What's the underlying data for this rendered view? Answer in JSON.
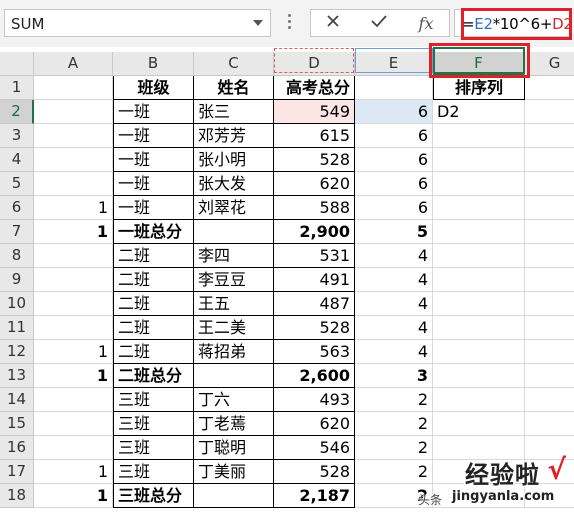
{
  "formula_bar": {
    "name_box": "SUM",
    "cancel_icon": "×",
    "enter_icon": "✓",
    "fx_label": "fx",
    "formula_parts": [
      {
        "text": "=",
        "color": "#000000"
      },
      {
        "text": "E2",
        "color": "#2f6fc7"
      },
      {
        "text": "*10^6+",
        "color": "#000000"
      },
      {
        "text": "D2",
        "color": "#d42a2a"
      }
    ]
  },
  "columns": [
    "",
    "A",
    "B",
    "C",
    "D",
    "E",
    "F",
    "G"
  ],
  "rows": [
    {
      "n": "1",
      "A": "",
      "B": "班级",
      "C": "姓名",
      "D": "高考总分",
      "E": "",
      "F": "排序列",
      "bold": true,
      "header": true
    },
    {
      "n": "2",
      "A": "",
      "B": "一班",
      "C": "张三",
      "D": "549",
      "E": "6",
      "F": "D2"
    },
    {
      "n": "3",
      "A": "",
      "B": "一班",
      "C": "邓芳芳",
      "D": "615",
      "E": "6",
      "F": ""
    },
    {
      "n": "4",
      "A": "",
      "B": "一班",
      "C": "张小明",
      "D": "528",
      "E": "6",
      "F": ""
    },
    {
      "n": "5",
      "A": "",
      "B": "一班",
      "C": "张大发",
      "D": "620",
      "E": "6",
      "F": ""
    },
    {
      "n": "6",
      "A": "1",
      "B": "一班",
      "C": "刘翠花",
      "D": "588",
      "E": "6",
      "F": ""
    },
    {
      "n": "7",
      "A": "1",
      "B": "一班总分",
      "C": "",
      "D": "2,900",
      "E": "5",
      "F": "",
      "bold": true
    },
    {
      "n": "8",
      "A": "",
      "B": "二班",
      "C": "李四",
      "D": "531",
      "E": "4",
      "F": ""
    },
    {
      "n": "9",
      "A": "",
      "B": "二班",
      "C": "李豆豆",
      "D": "491",
      "E": "4",
      "F": ""
    },
    {
      "n": "10",
      "A": "",
      "B": "二班",
      "C": "王五",
      "D": "487",
      "E": "4",
      "F": ""
    },
    {
      "n": "11",
      "A": "",
      "B": "二班",
      "C": "王二美",
      "D": "528",
      "E": "4",
      "F": ""
    },
    {
      "n": "12",
      "A": "1",
      "B": "二班",
      "C": "蒋招弟",
      "D": "563",
      "E": "4",
      "F": ""
    },
    {
      "n": "13",
      "A": "1",
      "B": "二班总分",
      "C": "",
      "D": "2,600",
      "E": "3",
      "F": "",
      "bold": true
    },
    {
      "n": "14",
      "A": "",
      "B": "三班",
      "C": "丁六",
      "D": "493",
      "E": "2",
      "F": ""
    },
    {
      "n": "15",
      "A": "",
      "B": "三班",
      "C": "丁老蔫",
      "D": "620",
      "E": "2",
      "F": ""
    },
    {
      "n": "16",
      "A": "",
      "B": "三班",
      "C": "丁聪明",
      "D": "546",
      "E": "2",
      "F": ""
    },
    {
      "n": "17",
      "A": "1",
      "B": "三班",
      "C": "丁美丽",
      "D": "528",
      "E": "2",
      "F": ""
    },
    {
      "n": "18",
      "A": "1",
      "B": "三班总分",
      "C": "",
      "D": "2,187",
      "E": "2",
      "F": "",
      "bold": true
    }
  ],
  "watermark": {
    "main": "经验啦",
    "check": "√",
    "sub": "头条",
    "url": "jingyanla.com"
  },
  "colors": {
    "accent_green": "#217346",
    "highlight_red": "#e0202a",
    "ref_blue": "#2f6fc7",
    "ref_red": "#d42a2a"
  }
}
